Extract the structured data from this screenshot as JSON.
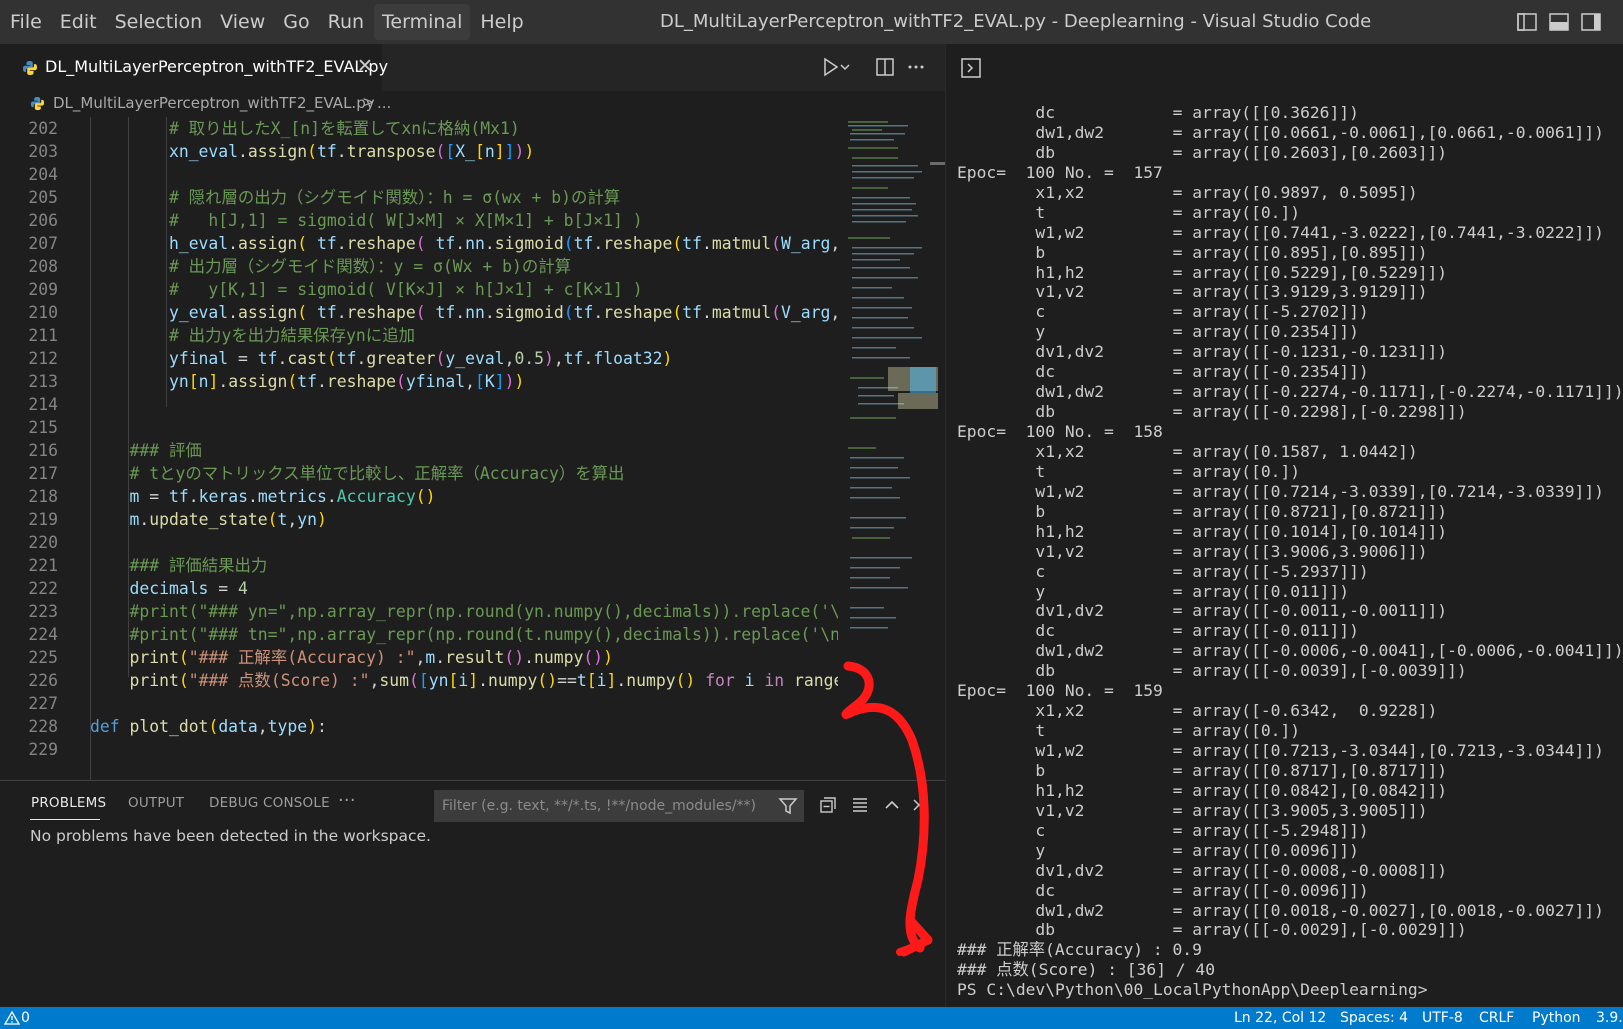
{
  "menu": {
    "items": [
      "File",
      "Edit",
      "Selection",
      "View",
      "Go",
      "Run",
      "Terminal",
      "Help"
    ],
    "active": "Terminal"
  },
  "window_title": "DL_MultiLayerPerceptron_withTF2_EVAL.py - Deeplearning - Visual Studio Code",
  "tab": {
    "label": "DL_MultiLayerPerceptron_withTF2_EVAL.py",
    "close": "✕"
  },
  "breadcrumb": {
    "file": "DL_MultiLayerPerceptron_withTF2_EVAL.py",
    "separator": ">",
    "more": "..."
  },
  "editor": {
    "line_numbers": [
      "202",
      "203",
      "204",
      "205",
      "206",
      "207",
      "208",
      "209",
      "210",
      "211",
      "212",
      "213",
      "214",
      "215",
      "216",
      "217",
      "218",
      "219",
      "220",
      "221",
      "222",
      "223",
      "224",
      "225",
      "226",
      "227",
      "228",
      "229"
    ]
  },
  "panel": {
    "tabs": [
      "PROBLEMS",
      "OUTPUT",
      "DEBUG CONSOLE"
    ],
    "more": "···",
    "filter_placeholder": "Filter (e.g. text, **/*.ts, !**/node_modules/**)",
    "message": "No problems have been detected in the workspace."
  },
  "terminal": {
    "lines": [
      "        dc            = array([[0.3626]])",
      "        dw1,dw2       = array([[0.0661,-0.0061],[0.0661,-0.0061]])",
      "        db            = array([[0.2603],[0.2603]])",
      "Epoc=  100 No. =  157",
      "        x1,x2         = array([0.9897, 0.5095])",
      "        t             = array([0.])",
      "        w1,w2         = array([[0.7441,-3.0222],[0.7441,-3.0222]])",
      "        b             = array([[0.895],[0.895]])",
      "        h1,h2         = array([[0.5229],[0.5229]])",
      "        v1,v2         = array([[3.9129,3.9129]])",
      "        c             = array([[-5.2702]])",
      "        y             = array([[0.2354]])",
      "        dv1,dv2       = array([[-0.1231,-0.1231]])",
      "        dc            = array([[-0.2354]])",
      "        dw1,dw2       = array([[-0.2274,-0.1171],[-0.2274,-0.1171]])",
      "        db            = array([[-0.2298],[-0.2298]])",
      "Epoc=  100 No. =  158",
      "        x1,x2         = array([0.1587, 1.0442])",
      "        t             = array([0.])",
      "        w1,w2         = array([[0.7214,-3.0339],[0.7214,-3.0339]])",
      "        b             = array([[0.8721],[0.8721]])",
      "        h1,h2         = array([[0.1014],[0.1014]])",
      "        v1,v2         = array([[3.9006,3.9006]])",
      "        c             = array([[-5.2937]])",
      "        y             = array([[0.011]])",
      "        dv1,dv2       = array([[-0.0011,-0.0011]])",
      "        dc            = array([[-0.011]])",
      "        dw1,dw2       = array([[-0.0006,-0.0041],[-0.0006,-0.0041]])",
      "        db            = array([[-0.0039],[-0.0039]])",
      "Epoc=  100 No. =  159",
      "        x1,x2         = array([-0.6342,  0.9228])",
      "        t             = array([0.])",
      "        w1,w2         = array([[0.7213,-3.0344],[0.7213,-3.0344]])",
      "        b             = array([[0.8717],[0.8717]])",
      "        h1,h2         = array([[0.0842],[0.0842]])",
      "        v1,v2         = array([[3.9005,3.9005]])",
      "        c             = array([[-5.2948]])",
      "        y             = array([[0.0096]])",
      "        dv1,dv2       = array([[-0.0008,-0.0008]])",
      "        dc            = array([[-0.0096]])",
      "        dw1,dw2       = array([[0.0018,-0.0027],[0.0018,-0.0027]])",
      "        db            = array([[-0.0029],[-0.0029]])",
      "### 正解率(Accuracy) : 0.9",
      "### 点数(Score) : [36] / 40",
      "PS C:\\dev\\Python\\00_LocalPythonApp\\Deeplearning>"
    ]
  },
  "statusbar": {
    "problems": "0",
    "position": "Ln 22, Col 12",
    "spaces": "Spaces: 4",
    "encoding": "UTF-8",
    "eol": "CRLF",
    "language": "Python",
    "version": "3.9."
  },
  "colors": {
    "statusbar": "#007acc",
    "annotation": "#ff0000",
    "titlebar": "#323233",
    "editor_bg": "#1e1e1e"
  },
  "icons": [
    "python-file-icon",
    "run-icon",
    "split-editor-icon",
    "terminal-toggle-icon",
    "filter-icon",
    "collapse-all-icon",
    "list-view-icon",
    "chevron-up-icon",
    "close-icon",
    "warning-icon",
    "layout-sidebar-icon",
    "layout-panel-icon"
  ]
}
